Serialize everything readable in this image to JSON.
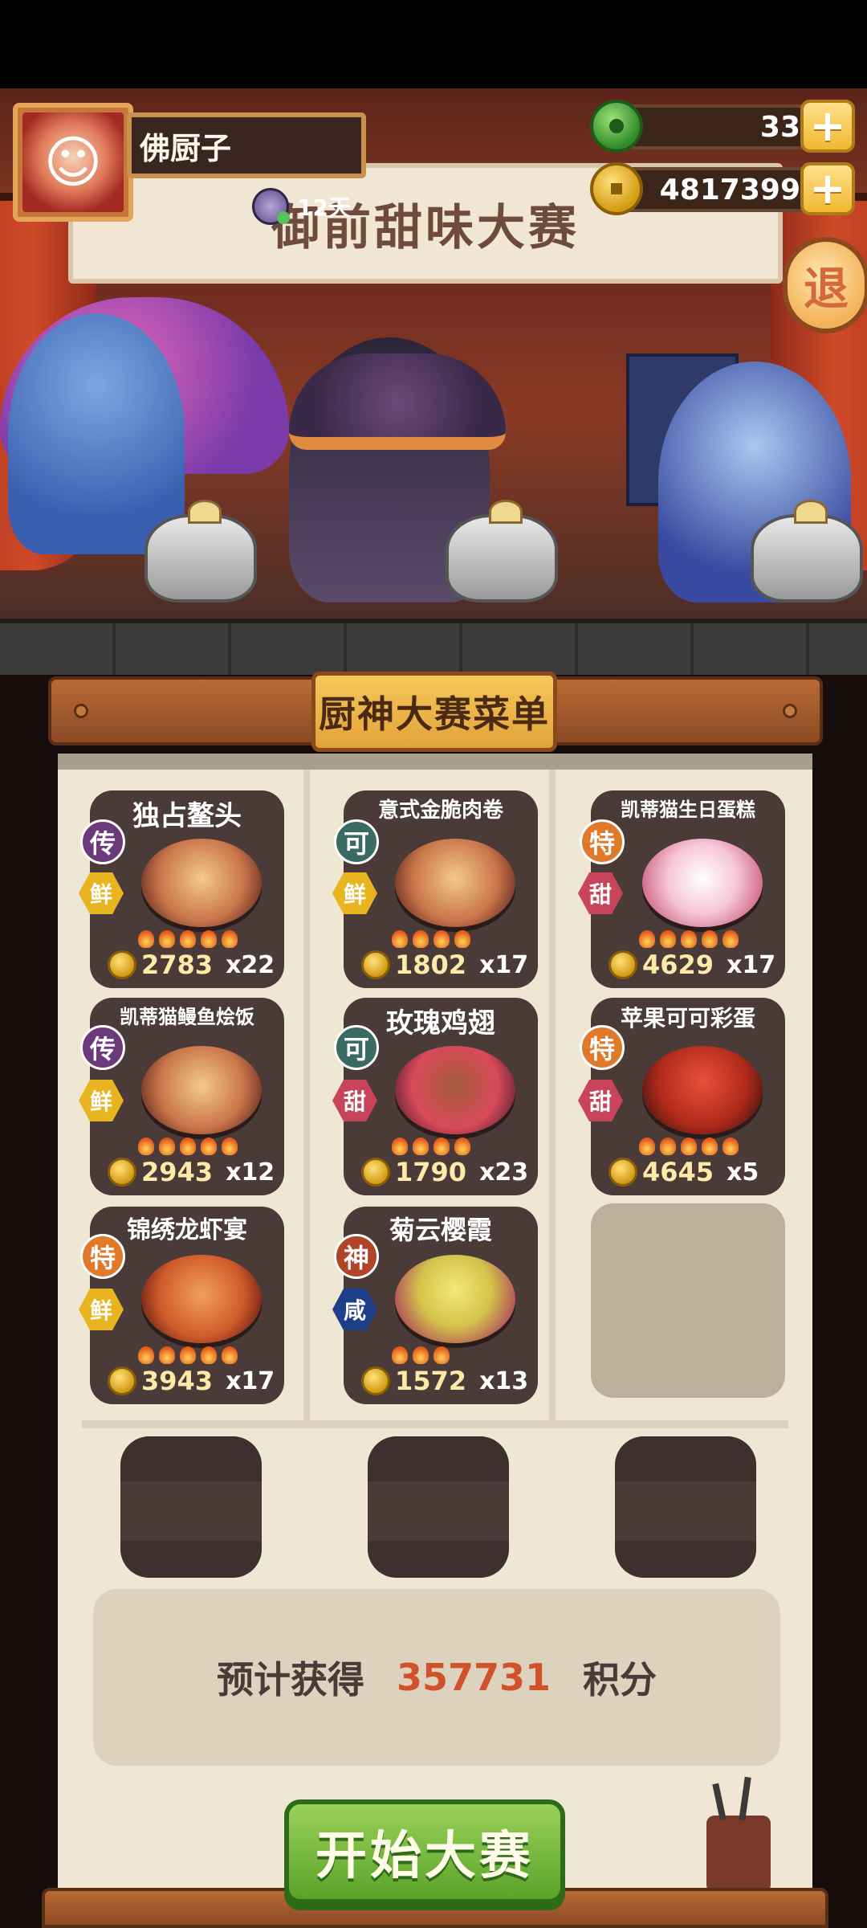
{
  "header": {
    "player_name": "佛厨子",
    "days_text": "12天",
    "jade_count": "33",
    "coin_count": "4817399",
    "plus_label": "+",
    "exit_label": "退"
  },
  "stage": {
    "banner_title": "御前甜味大赛"
  },
  "menu": {
    "sign_title": "厨神大赛菜单",
    "dishes": [
      {
        "name": "独占鳌头",
        "rank": "传",
        "flavor": "鲜",
        "price": "2783",
        "qty": "x22"
      },
      {
        "name": "意式金脆肉卷",
        "rank": "可",
        "flavor": "鲜",
        "price": "1802",
        "qty": "x17"
      },
      {
        "name": "凯蒂猫生日蛋糕",
        "rank": "特",
        "flavor": "甜",
        "price": "4629",
        "qty": "x17"
      },
      {
        "name": "凯蒂猫鳗鱼烩饭",
        "rank": "传",
        "flavor": "鲜",
        "price": "2943",
        "qty": "x12"
      },
      {
        "name": "玫瑰鸡翅",
        "rank": "可",
        "flavor": "甜",
        "price": "1790",
        "qty": "x23"
      },
      {
        "name": "苹果可可彩蛋",
        "rank": "特",
        "flavor": "甜",
        "price": "4645",
        "qty": "x5"
      },
      {
        "name": "锦绣龙虾宴",
        "rank": "特",
        "flavor": "鲜",
        "price": "3943",
        "qty": "x17"
      },
      {
        "name": "菊云樱霞",
        "rank": "神",
        "flavor": "咸",
        "price": "1572",
        "qty": "x13"
      }
    ]
  },
  "forecast": {
    "prefix": "预计获得",
    "score": "357731",
    "suffix": "积分"
  },
  "start_button": "开始大赛",
  "colors": {
    "rank_chuan": "#6a3a7a",
    "rank_ke": "#3a6a64",
    "rank_te": "#e07a2a",
    "rank_shen": "#b0452a",
    "flavor_xian": "#e8b420",
    "flavor_tian": "#c8445a",
    "flavor_xian_salty": "#1f3f8a",
    "start_green": "#6ab43a"
  }
}
